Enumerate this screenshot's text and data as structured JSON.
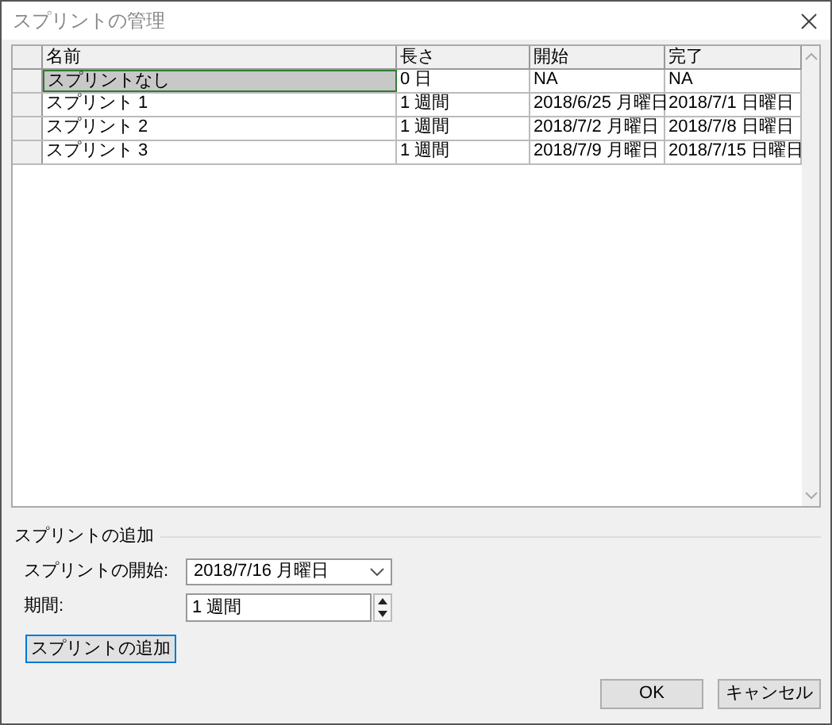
{
  "window": {
    "title": "スプリントの管理"
  },
  "table": {
    "columns": [
      "名前",
      "長さ",
      "開始",
      "完了"
    ],
    "rows": [
      {
        "cells": [
          "スプリントなし",
          "0 日",
          "NA",
          "NA"
        ],
        "selected": true
      },
      {
        "cells": [
          "スプリント 1",
          "1 週間",
          "2018/6/25 月曜日",
          "2018/7/1 日曜日"
        ],
        "selected": false
      },
      {
        "cells": [
          "スプリント 2",
          "1 週間",
          "2018/7/2 月曜日",
          "2018/7/8 日曜日"
        ],
        "selected": false
      },
      {
        "cells": [
          "スプリント 3",
          "1 週間",
          "2018/7/9 月曜日",
          "2018/7/15 日曜日"
        ],
        "selected": false
      }
    ]
  },
  "add_section": {
    "title": "スプリントの追加",
    "start_label": "スプリントの開始:",
    "start_value": "2018/7/16 月曜日",
    "duration_label": "期間:",
    "duration_value": "1 週間",
    "add_button": "スプリントの追加"
  },
  "buttons": [
    "OK",
    "キャンセル"
  ]
}
